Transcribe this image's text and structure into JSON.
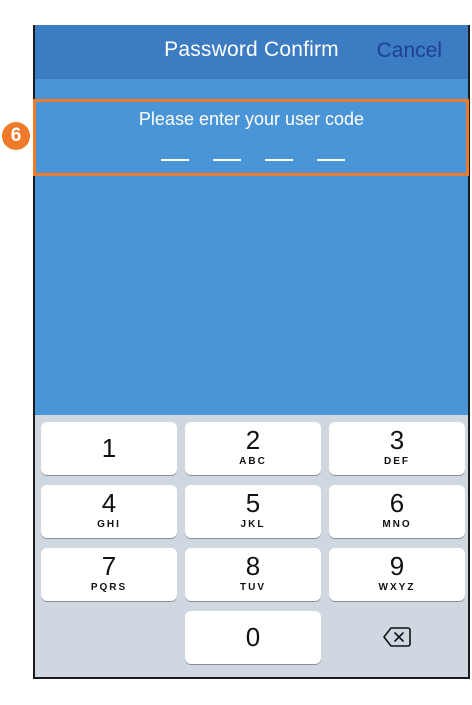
{
  "header": {
    "title": "Password Confirm",
    "cancel_label": "Cancel"
  },
  "prompt": {
    "text": "Please enter your user code",
    "code_slots": 4
  },
  "callout": {
    "number": "6"
  },
  "keypad": {
    "keys": [
      {
        "digit": "1",
        "letters": ""
      },
      {
        "digit": "2",
        "letters": "ABC"
      },
      {
        "digit": "3",
        "letters": "DEF"
      },
      {
        "digit": "4",
        "letters": "GHI"
      },
      {
        "digit": "5",
        "letters": "JKL"
      },
      {
        "digit": "6",
        "letters": "MNO"
      },
      {
        "digit": "7",
        "letters": "PQRS"
      },
      {
        "digit": "8",
        "letters": "TUV"
      },
      {
        "digit": "9",
        "letters": "WXYZ"
      },
      {
        "digit": "0",
        "letters": ""
      }
    ],
    "delete_icon": "backspace-icon"
  },
  "colors": {
    "header_bg": "#3c7cc3",
    "screen_bg": "#4a95d7",
    "cancel_text": "#1f3f95",
    "highlight_border": "#ee7a2a",
    "keypad_bg": "#cfd7e1"
  }
}
